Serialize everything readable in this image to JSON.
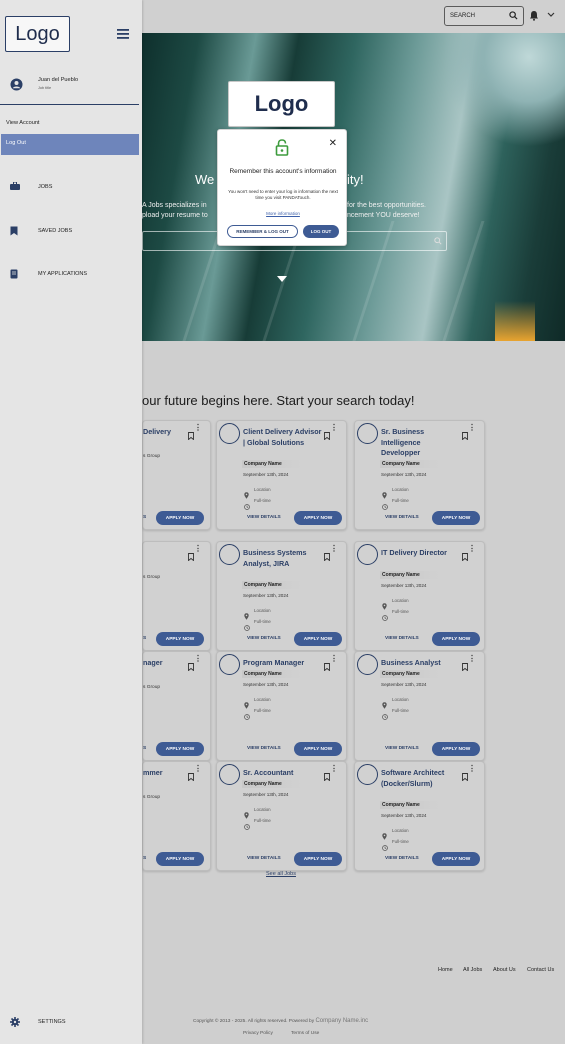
{
  "top": {
    "search_label": "SEARCH",
    "icons": {
      "search": "search-icon",
      "bell": "bell-icon",
      "chevron": "chevron-down-icon"
    }
  },
  "hero": {
    "logo": "Logo",
    "headline_left": "We",
    "headline_right": "ity!",
    "sub_line1_left": "A Jobs specializes in",
    "sub_line1_right": "for the best opportunities.",
    "sub_line2_left": "pload your resume to",
    "sub_line2_right": "ncement YOU deserve!"
  },
  "modal": {
    "title": "Remember this account's information",
    "body": "You won't need to enter your log in information the next time you visit PANDATouch.",
    "more_link": "More information",
    "remember_button": "REMEMBER & LOG OUT",
    "logout_button": "LOG OUT"
  },
  "main": {
    "heading": "our future begins here. Start your search today!",
    "see_all": "See all Jobs"
  },
  "partial_cards": [
    {
      "title": "Delivery",
      "sub": "s Group"
    },
    {
      "title": "",
      "sub": "s Group"
    },
    {
      "title": "nager",
      "sub": "s Group"
    },
    {
      "title": "mmer",
      "sub": "s Group"
    }
  ],
  "partial_labels": {
    "view": "S",
    "apply": "APPLY NOW"
  },
  "cards": [
    {
      "title": "Client Delivery Advisor | Global Solutions",
      "company": "Company Name",
      "date": "September 13th, 2024",
      "location": "Location",
      "type": "Full-time",
      "view": "VIEW DETAILS",
      "apply": "APPLY NOW"
    },
    {
      "title": "Sr. Business Intelligence Developper",
      "company": "Company Name",
      "date": "September 13th, 2024",
      "location": "Location",
      "type": "Full-time",
      "view": "VIEW DETAILS",
      "apply": "APPLY NOW"
    },
    {
      "title": "Business Systems Analyst, JIRA",
      "company": "Company Name",
      "date": "September 13th, 2024",
      "location": "Location",
      "type": "Full-time",
      "view": "VIEW DETAILS",
      "apply": "APPLY NOW"
    },
    {
      "title": "IT Delivery Director",
      "company": "Company Name",
      "date": "September 13th, 2024",
      "location": "Location",
      "type": "Full-time",
      "view": "VIEW DETAILS",
      "apply": "APPLY NOW"
    },
    {
      "title": "Program Manager",
      "company": "Company Name",
      "date": "September 13th, 2024",
      "location": "Location",
      "type": "Full-time",
      "view": "VIEW DETAILS",
      "apply": "APPLY NOW"
    },
    {
      "title": "Business Analyst",
      "company": "Company Name",
      "date": "September 13th, 2024",
      "location": "Location",
      "type": "Full-time",
      "view": "VIEW DETAILS",
      "apply": "APPLY NOW"
    },
    {
      "title": "Sr. Accountant",
      "company": "Company Name",
      "date": "September 13th, 2024",
      "location": "Location",
      "type": "Full-time",
      "view": "VIEW DETAILS",
      "apply": "APPLY NOW"
    },
    {
      "title": "Software Architect (Docker/Slurm)",
      "company": "Company Name",
      "date": "September 13th, 2024",
      "location": "Location",
      "type": "Full-time",
      "view": "VIEW DETAILS",
      "apply": "APPLY NOW"
    }
  ],
  "footer": {
    "links": [
      "Home",
      "All Jobs",
      "About Us",
      "Contact Us"
    ],
    "copyright": "Copyright © 2013 - 2025. All rights reserved. Powered by",
    "company": "Company Name.inc",
    "privacy": "Privacy Policy",
    "terms": "Terms of Use"
  },
  "sidebar": {
    "logo": "Logo",
    "user_name": "Juan del Pueblo",
    "user_title": "Job title",
    "view_account": "View Account",
    "log_out": "Log Out",
    "nav": [
      "JOBS",
      "SAVED JOBS",
      "MY APPLICATIONS"
    ],
    "settings": "SETTINGS"
  },
  "colors": {
    "accent": "#3e5b94",
    "title": "#2b3f66",
    "highlight": "#6e85bb"
  }
}
